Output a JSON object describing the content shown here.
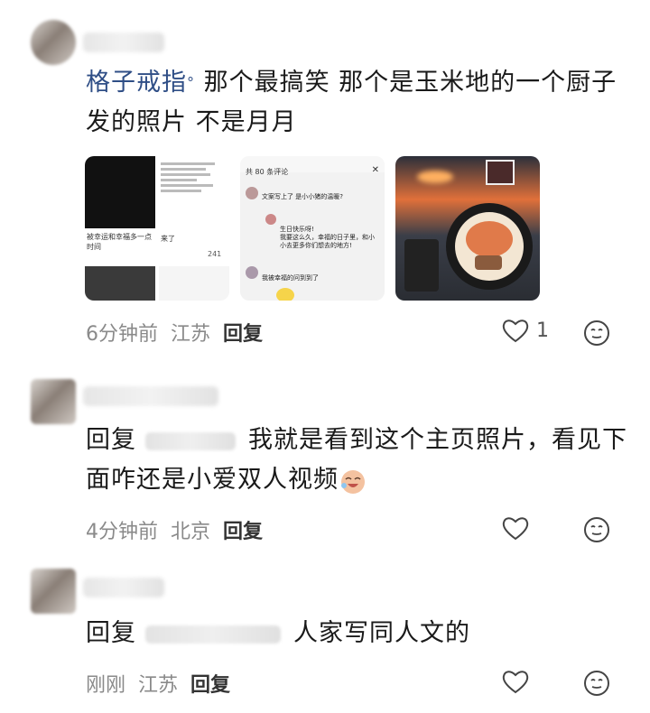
{
  "comments": [
    {
      "author_link": "格子戒指",
      "text": "那个最搞笑 那个是玉米地的一个厨子发的照片 不是月月",
      "time": "6分钟前",
      "location": "江苏",
      "reply_label": "回复",
      "like_count": "1",
      "images": [
        {
          "caption_1": "被幸运和幸福多一点时间",
          "caption_2": "来了",
          "like": "241"
        },
        {
          "header": "共 80 条评论",
          "line_1": "文案写上了 是小小猪的温暖?",
          "line_2": "生日快乐呀!",
          "line_3": "我要这么久，幸福的日子里，和小小去更多你们想去的地方!",
          "line_4": "我被幸福的问到到了"
        },
        {}
      ]
    },
    {
      "reply_prefix": "回复",
      "text": "我就是看到这个主页照片，看见下面咋还是小爱双人视频",
      "time": "4分钟前",
      "location": "北京",
      "reply_label": "回复"
    },
    {
      "reply_prefix": "回复",
      "text": "人家写同人文的",
      "time": "刚刚",
      "location": "江苏",
      "reply_label": "回复"
    }
  ]
}
